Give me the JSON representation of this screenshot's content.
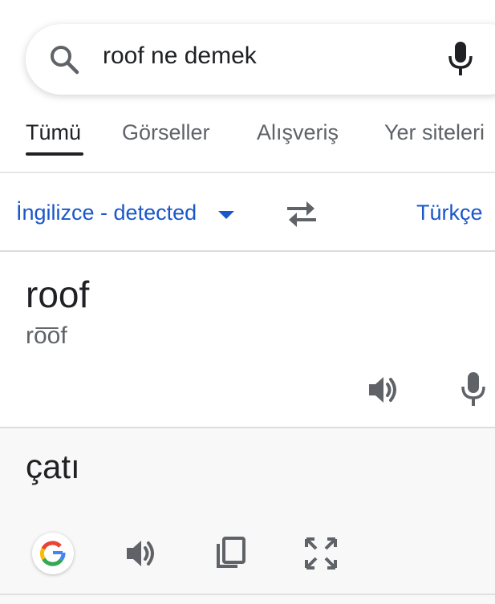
{
  "search": {
    "query": "roof ne demek"
  },
  "tabs": [
    {
      "label": "Tümü",
      "active": true
    },
    {
      "label": "Görseller",
      "active": false
    },
    {
      "label": "Alışveriş",
      "active": false
    },
    {
      "label": "Yer siteleri",
      "active": false
    }
  ],
  "translate": {
    "source_language": "İngilizce - detected",
    "target_language": "Türkçe",
    "source_text": "roof",
    "source_phonetic": "ro͞of",
    "translated_text": "çatı"
  },
  "icons": {
    "search": "search-icon",
    "mic": "microphone-icon",
    "swap": "swap-languages-icon",
    "speaker": "speaker-icon",
    "copy": "copy-icon",
    "fullscreen": "fullscreen-icon",
    "google": "google-logo"
  },
  "colors": {
    "link_blue": "#1a57c8",
    "icon_gray": "#5f6368",
    "text": "#202124",
    "result_panel_bg": "#f8f8f8"
  }
}
